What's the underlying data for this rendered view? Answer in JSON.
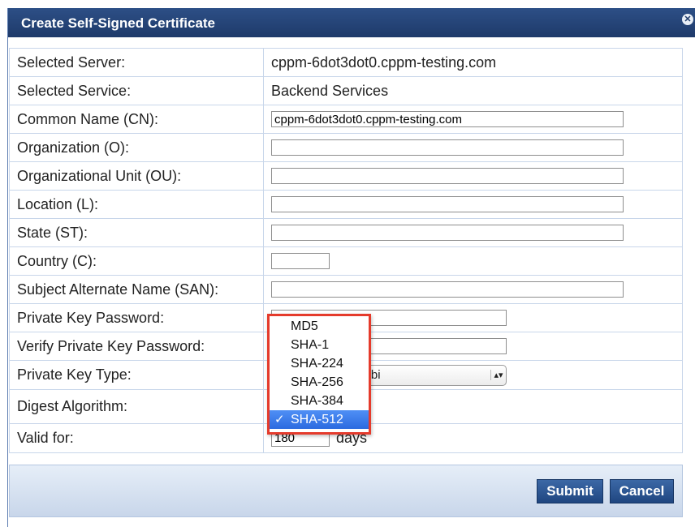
{
  "dialog": {
    "title": "Create Self-Signed Certificate"
  },
  "form": {
    "selected_server_label": "Selected Server:",
    "selected_server_value": "cppm-6dot3dot0.cppm-testing.com",
    "selected_service_label": "Selected Service:",
    "selected_service_value": "Backend Services",
    "common_name_label": "Common Name (CN):",
    "common_name_value": "cppm-6dot3dot0.cppm-testing.com",
    "organization_label": "Organization (O):",
    "organization_value": "",
    "org_unit_label": "Organizational Unit (OU):",
    "org_unit_value": "",
    "location_label": "Location (L):",
    "location_value": "",
    "state_label": "State (ST):",
    "state_value": "",
    "country_label": "Country (C):",
    "country_value": "",
    "san_label": "Subject Alternate Name (SAN):",
    "san_value": "",
    "pk_password_label": "Private Key Password:",
    "pk_password_value": "",
    "verify_pk_password_label": "Verify Private Key Password:",
    "verify_pk_password_value": "",
    "pk_type_label": "Private Key Type:",
    "pk_type_value": "curve over a 256 bi",
    "digest_label": "Digest Algorithm:",
    "valid_for_label": "Valid for:",
    "valid_for_value": "180",
    "valid_for_unit": "days"
  },
  "digest_dropdown": {
    "options": [
      "MD5",
      "SHA-1",
      "SHA-224",
      "SHA-256",
      "SHA-384",
      "SHA-512"
    ],
    "selected": "SHA-512",
    "check_mark": "✓",
    "highlight_color": "#e53b2c"
  },
  "footer": {
    "submit_label": "Submit",
    "cancel_label": "Cancel"
  },
  "colors": {
    "titlebar": "#1e3a6a",
    "button": "#2a5694",
    "selection": "#2c6be0"
  }
}
